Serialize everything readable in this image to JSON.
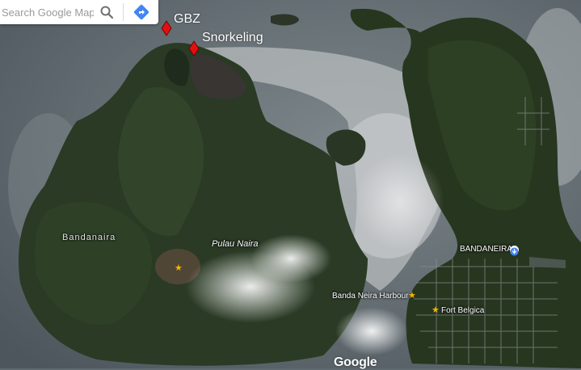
{
  "search": {
    "placeholder": "Search Google Maps"
  },
  "icons": {
    "search": "search-icon",
    "directions": "directions-icon",
    "annotation_marker": "diamond-marker-icon",
    "poi": "star-icon",
    "info": "info-icon"
  },
  "annotations": [
    {
      "label": "GBZ",
      "color": "#e01010"
    },
    {
      "label": "Snorkeling",
      "color": "#e01010"
    }
  ],
  "places": {
    "bandanaira": "Bandanaira",
    "pulau_naira": "Pulau Naira",
    "bandaneira": "BANDANEIRA",
    "harbour": "Banda Neira Harbour",
    "fort": "Fort Belgica"
  },
  "colors": {
    "poi_star": "#f5b400",
    "info_icon": "#4285f4",
    "directions_icon": "#4285f4"
  },
  "watermark": "Google"
}
